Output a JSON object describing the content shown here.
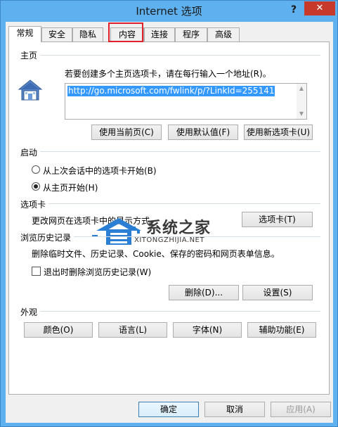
{
  "window": {
    "title": "Internet 选项",
    "help": "?",
    "close": "✕"
  },
  "tabs": [
    {
      "label": "常规",
      "active": true
    },
    {
      "label": "安全"
    },
    {
      "label": "隐私"
    },
    {
      "label": "内容",
      "highlighted": true
    },
    {
      "label": "连接"
    },
    {
      "label": "程序"
    },
    {
      "label": "高级"
    }
  ],
  "homepage": {
    "section": "主页",
    "instruction": "若要创建多个主页选项卡，请在每行输入一个地址(R)。",
    "url": "http://go.microsoft.com/fwlink/p/?LinkId=255141",
    "btn_current": "使用当前页(C)",
    "btn_default": "使用默认值(F)",
    "btn_newtab": "使用新选项卡(U)"
  },
  "startup": {
    "section": "启动",
    "option_last": "从上次会话中的选项卡开始(B)",
    "option_home": "从主页开始(H)",
    "selected": "option_home"
  },
  "tabs_section": {
    "section": "选项卡",
    "description": "更改网页在选项卡中的显示方式。",
    "button": "选项卡(T)"
  },
  "history": {
    "section": "浏览历史记录",
    "description": "删除临时文件、历史记录、Cookie、保存的密码和网页表单信息。",
    "checkbox": "退出时删除浏览历史记录(W)",
    "checked": false,
    "btn_delete": "删除(D)...",
    "btn_settings": "设置(S)"
  },
  "appearance": {
    "section": "外观",
    "btn_colors": "颜色(O)",
    "btn_languages": "语言(L)",
    "btn_fonts": "字体(N)",
    "btn_accessibility": "辅助功能(E)"
  },
  "footer": {
    "ok": "确定",
    "cancel": "取消",
    "apply": "应用(A)"
  },
  "watermark": {
    "name": "系统之家",
    "url": "XITONGZHIJIA.NET"
  },
  "colors": {
    "titlebar": "#5fb0ee",
    "close": "#c7392b",
    "selection": "#3399ff",
    "highlight_box": "#e0202a"
  }
}
